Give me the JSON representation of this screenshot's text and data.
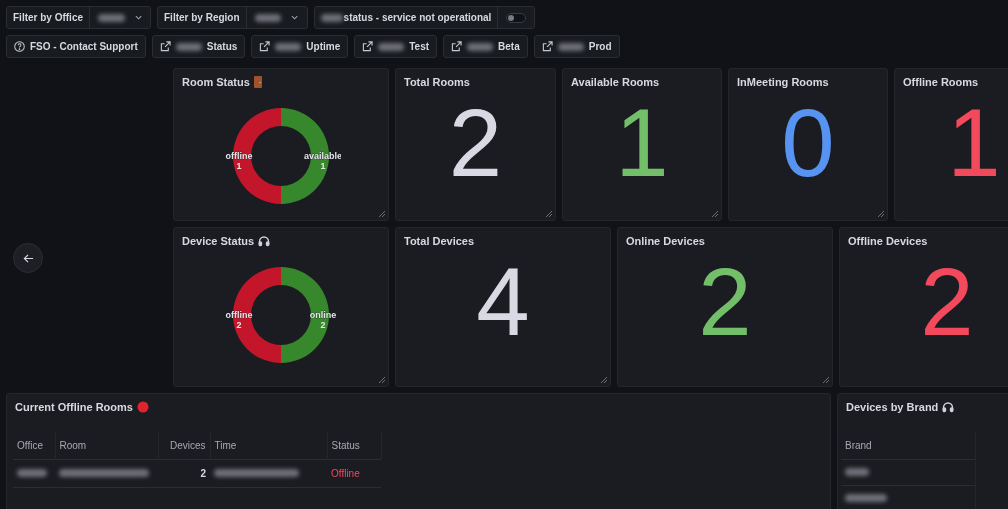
{
  "filters": [
    {
      "label": "Filter by Office",
      "value_blurred": true
    },
    {
      "label": "Filter by Region",
      "value_blurred": true
    }
  ],
  "toggle": {
    "label": "status - service not operational",
    "prefix_blurred": true,
    "on": false
  },
  "links": [
    {
      "label": "FSO - Contact Support",
      "kind": "help",
      "prefix_blurred": false
    },
    {
      "label": "Status",
      "kind": "external",
      "prefix_blurred": true
    },
    {
      "label": "Uptime",
      "kind": "external",
      "prefix_blurred": true
    },
    {
      "label": "Test",
      "kind": "external",
      "prefix_blurred": true
    },
    {
      "label": "Beta",
      "kind": "external",
      "prefix_blurred": true
    },
    {
      "label": "Prod",
      "kind": "external",
      "prefix_blurred": true
    }
  ],
  "room_row": {
    "donut": {
      "title": "Room Status",
      "chart_data": {
        "type": "donut",
        "categories": [
          "available",
          "offline"
        ],
        "values": [
          1,
          1
        ],
        "colors": [
          "#37872d",
          "#c4162a"
        ],
        "value_labels": [
          "1",
          "1"
        ]
      }
    },
    "stats": [
      {
        "title": "Total Rooms",
        "value": "2",
        "color": "#d8d9e3"
      },
      {
        "title": "Available Rooms",
        "value": "1",
        "color": "#73bf69"
      },
      {
        "title": "InMeeting Rooms",
        "value": "0",
        "color": "#5794f2"
      },
      {
        "title": "Offline Rooms",
        "value": "1",
        "color": "#f2495c"
      }
    ]
  },
  "device_row": {
    "donut": {
      "title": "Device Status",
      "chart_data": {
        "type": "donut",
        "categories": [
          "online",
          "offline"
        ],
        "values": [
          2,
          2
        ],
        "colors": [
          "#37872d",
          "#c4162a"
        ],
        "value_labels": [
          "2",
          "2"
        ]
      }
    },
    "stats": [
      {
        "title": "Total Devices",
        "value": "4",
        "color": "#d8d9e3"
      },
      {
        "title": "Online Devices",
        "value": "2",
        "color": "#73bf69"
      },
      {
        "title": "Offline Devices",
        "value": "2",
        "color": "#f2495c"
      }
    ]
  },
  "offline_rooms": {
    "title": "Current Offline Rooms",
    "columns": [
      "Office",
      "Room",
      "Devices",
      "Time",
      "Status"
    ],
    "rows": [
      {
        "office_blurred": true,
        "room_blurred": true,
        "devices": "2",
        "time_blurred": true,
        "status": "Offline"
      }
    ]
  },
  "devices_by_brand": {
    "title": "Devices by Brand",
    "columns": [
      "Brand"
    ],
    "rows": [
      {
        "brand_blurred": true
      },
      {
        "brand_blurred": true
      }
    ]
  }
}
